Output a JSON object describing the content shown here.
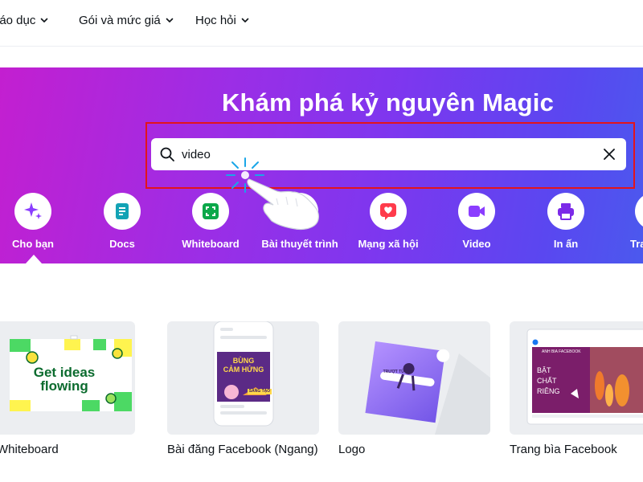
{
  "nav": {
    "items": [
      {
        "label": "iáo dục"
      },
      {
        "label": "Gói và mức giá"
      },
      {
        "label": "Học hỏi"
      }
    ]
  },
  "hero": {
    "title": "Khám phá kỷ nguyên Magic",
    "search": {
      "value": "video"
    },
    "categories": [
      {
        "label": "Cho bạn",
        "icon": "sparkle-icon",
        "color": "#8b3dff",
        "active": true
      },
      {
        "label": "Docs",
        "icon": "docs-icon",
        "color": "#13a3b5"
      },
      {
        "label": "Whiteboard",
        "icon": "whiteboard-icon",
        "color": "#0ba84a"
      },
      {
        "label": "Bài thuyết trình",
        "icon": "presentation-icon",
        "color": "#ff9105"
      },
      {
        "label": "Mạng xã hội",
        "icon": "heart-icon",
        "color": "#ff3b4b"
      },
      {
        "label": "Video",
        "icon": "video-icon",
        "color": "#8b3dff"
      },
      {
        "label": "In ấn",
        "icon": "printer-icon",
        "color": "#7c2ae8"
      },
      {
        "label": "Tra",
        "icon": "website-icon",
        "color": "#ffffff"
      }
    ]
  },
  "templates": [
    {
      "label": "Whiteboard",
      "thumb": {
        "line1": "Get ideas",
        "line2": "flowing"
      }
    },
    {
      "label": "Bài đăng Facebook (Ngang)",
      "thumb": {
        "line1": "BÙNG",
        "line2": "CẢM HỨNG",
        "tag": "SÁNG TẠO"
      }
    },
    {
      "label": "Logo",
      "thumb": {
        "tag": "TRƯỢT TỪ"
      }
    },
    {
      "label": "Trang bìa Facebook",
      "thumb": {
        "header": "ANH BIA FACEBOOK",
        "line1": "BẬT",
        "line2": "CHẤT",
        "line3": "RIÊNG"
      }
    }
  ],
  "colors": {
    "brand_purple": "#8b3dff",
    "highlight_red": "#e3141b"
  }
}
